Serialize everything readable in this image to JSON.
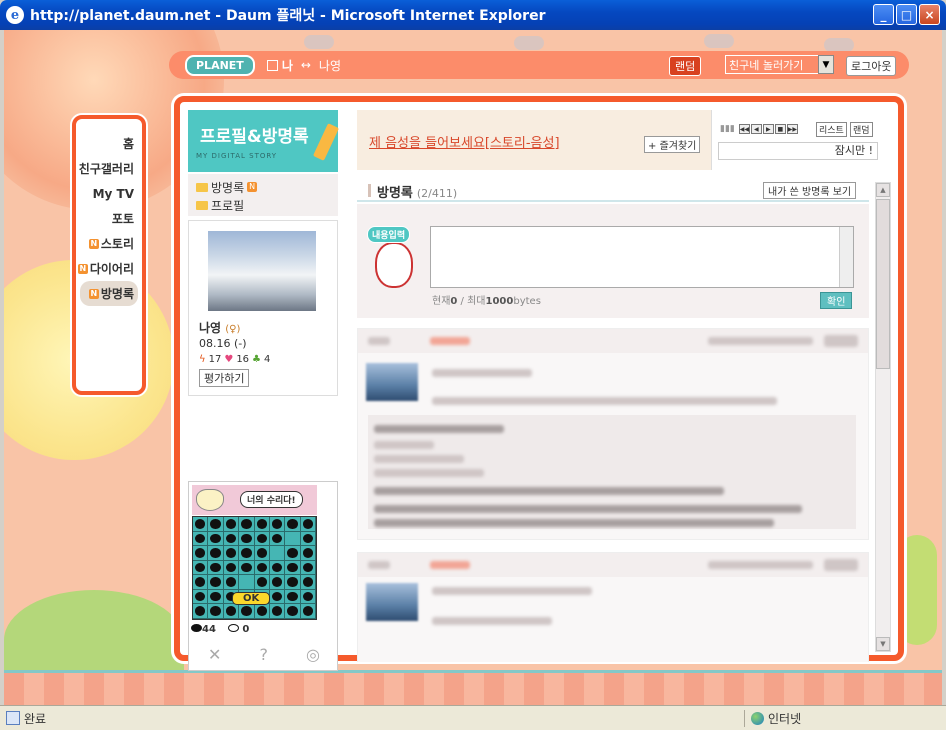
{
  "window": {
    "title": "http://planet.daum.net - Daum 플래닛 - Microsoft Internet Explorer"
  },
  "topnav": {
    "logo": "PLANET",
    "me": "나",
    "arrow": "↔",
    "user": "나영",
    "random": "랜덤",
    "friend_select": "친구네 놀러가기",
    "login": "로그아웃"
  },
  "menu": {
    "items": [
      {
        "label": "홈",
        "badge": false
      },
      {
        "label": "친구갤러리",
        "badge": false
      },
      {
        "label": "My TV",
        "badge": false
      },
      {
        "label": "포토",
        "badge": false
      },
      {
        "label": "스토리",
        "badge": true
      },
      {
        "label": "다이어리",
        "badge": true
      },
      {
        "label": "방명록",
        "badge": true,
        "active": true
      }
    ],
    "badge_text": "N"
  },
  "profile": {
    "banner_title": "프로필&방명록",
    "banner_sub": "MY DIGITAL STORY",
    "links": [
      "방명록",
      "프로필"
    ],
    "name": "나영",
    "gender": "(♀)",
    "birth": "08.16 (-)",
    "stats": {
      "bolt": "17",
      "heart": "16",
      "clover": "4"
    },
    "rate_button": "평가하기"
  },
  "game": {
    "bubble": "너의 수리다!",
    "ok": "OK",
    "black_count": "44",
    "white_count": "0"
  },
  "music": {
    "title": "제 음성을 들어보세요[스토리-음성]",
    "fav_button": "+ 즐겨찾기",
    "list_button": "리스트",
    "random_button": "랜덤",
    "status": "잠시만 !"
  },
  "guestbook": {
    "title": "방명록",
    "count": "(2/411)",
    "my_button": "내가 쓴 방명록 보기",
    "bubble": "내용입력",
    "limit_prefix": "현재",
    "limit_current": "0",
    "limit_sep": " / 최대",
    "limit_max": "1000",
    "limit_unit": "bytes",
    "confirm": "확인"
  },
  "statusbar": {
    "left": "완료",
    "zone": "인터넷"
  },
  "colors": {
    "accent": "#f55a2c",
    "topnav": "#fc8c6a",
    "teal": "#4fc7c3"
  }
}
